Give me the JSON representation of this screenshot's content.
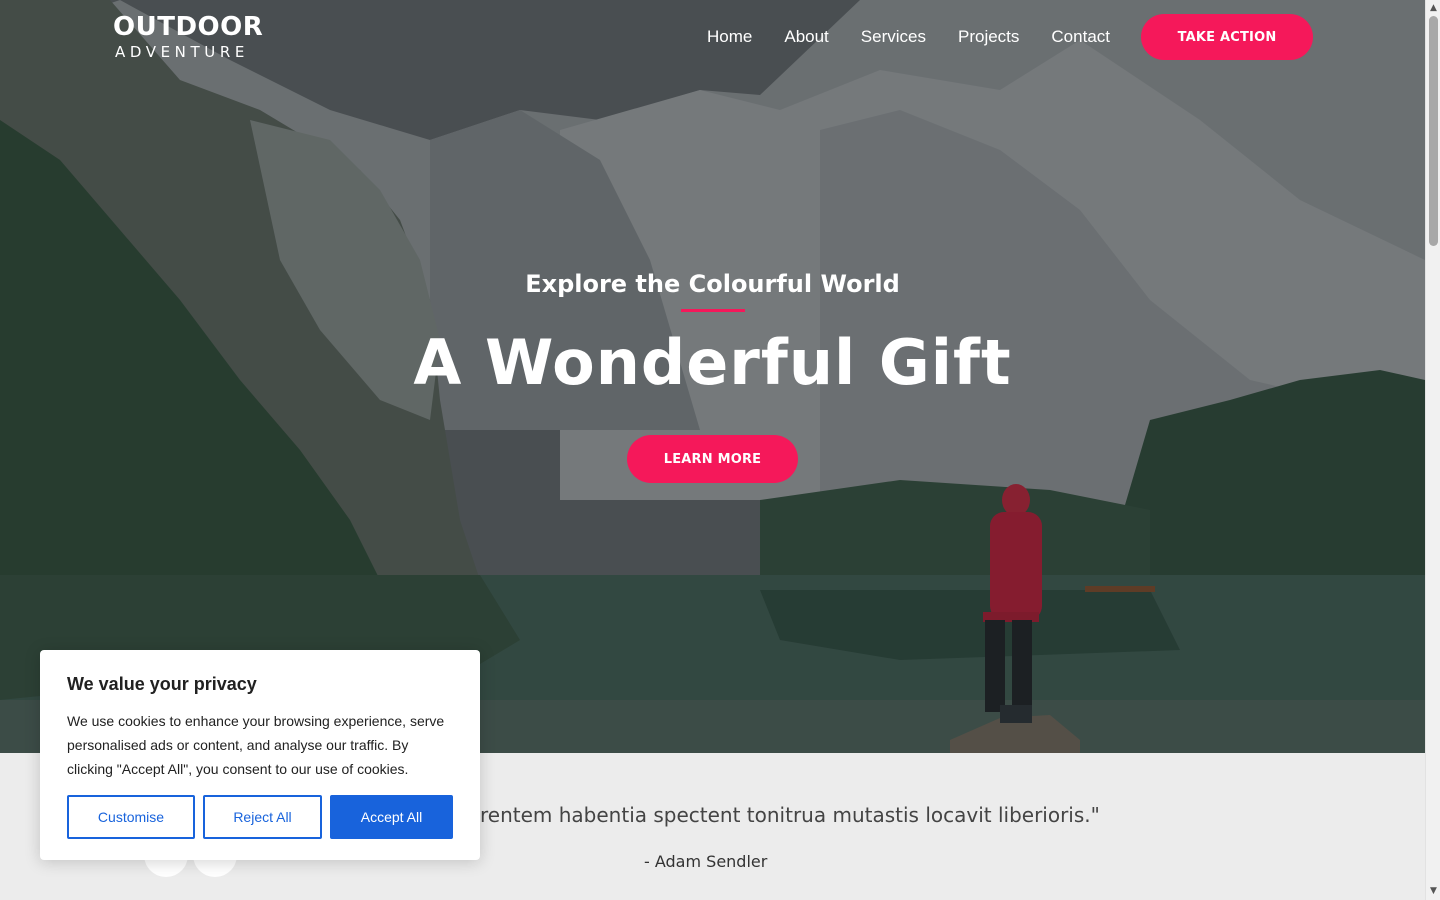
{
  "header": {
    "logo_main": "OUTDOOR",
    "logo_sub": "ADVENTURE",
    "nav": [
      {
        "label": "Home"
      },
      {
        "label": "About"
      },
      {
        "label": "Services"
      },
      {
        "label": "Projects"
      },
      {
        "label": "Contact"
      }
    ],
    "cta_label": "TAKE ACTION"
  },
  "hero": {
    "subtitle": "Explore the Colourful World",
    "title": "A Wonderful Gift",
    "button_label": "LEARN MORE"
  },
  "testimonial": {
    "quote": "rentem habentia spectent tonitrua mutastis locavit liberioris.\"",
    "author": "- Adam Sendler"
  },
  "cookie_banner": {
    "title": "We value your privacy",
    "text": "We use cookies to enhance your browsing experience, serve personalised ads or content, and analyse our traffic. By clicking \"Accept All\", you consent to our use of cookies.",
    "customise_label": "Customise",
    "reject_label": "Reject All",
    "accept_label": "Accept All"
  },
  "colors": {
    "accent": "#f5185a",
    "cookie_blue": "#1863dc"
  },
  "icons": {
    "scroll_up": "▲",
    "scroll_down": "▼"
  }
}
